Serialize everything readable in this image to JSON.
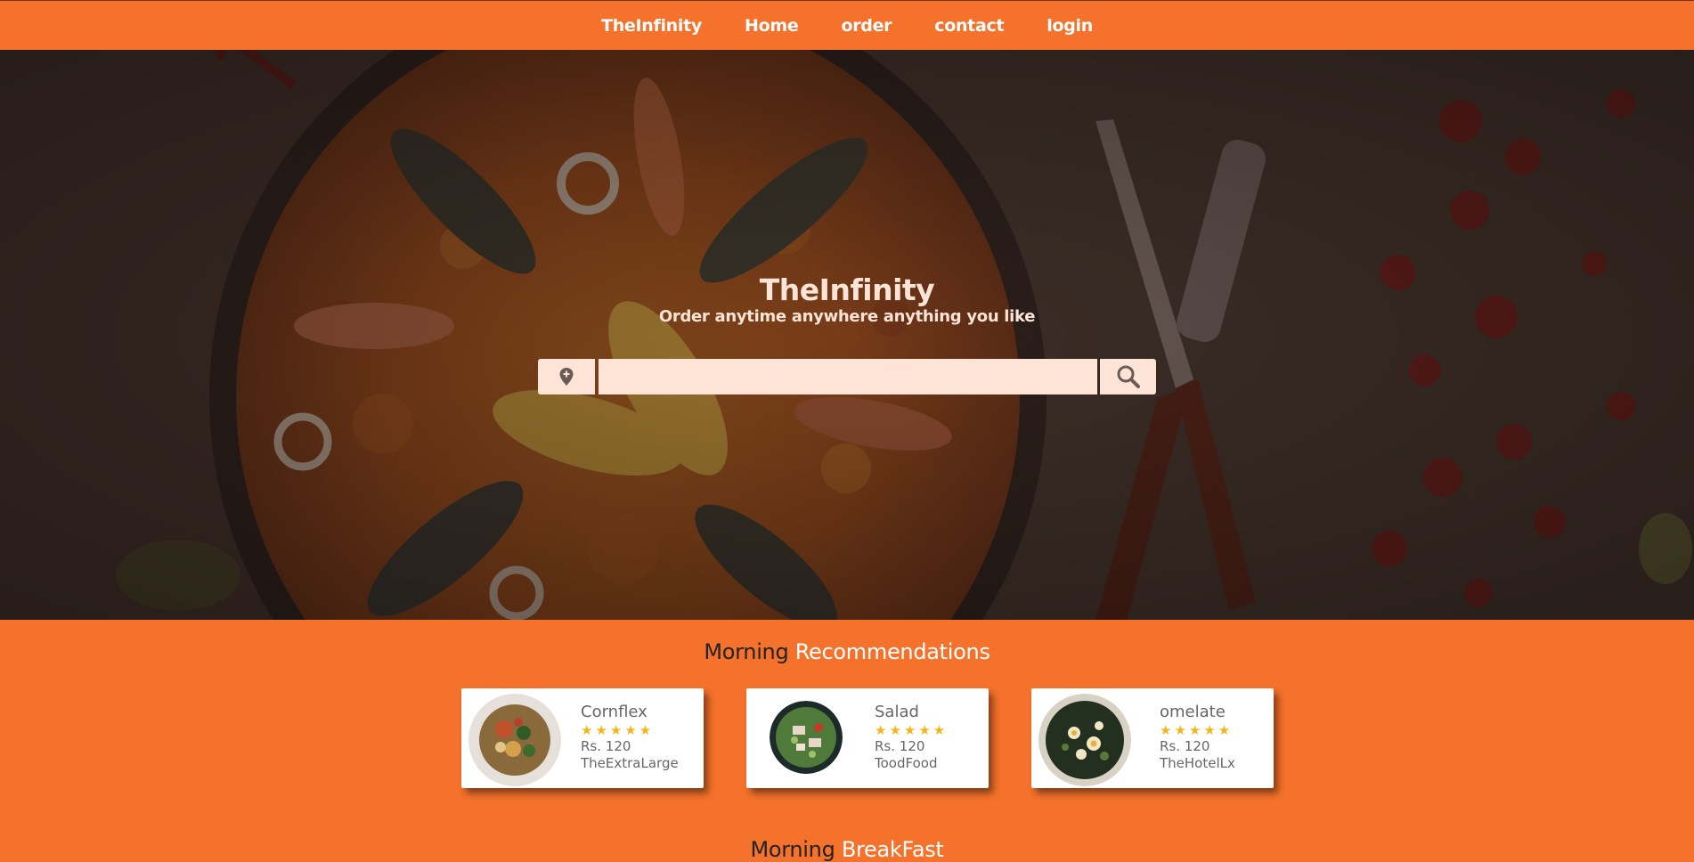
{
  "nav": {
    "items": [
      {
        "label": "TheInfinity"
      },
      {
        "label": "Home"
      },
      {
        "label": "order"
      },
      {
        "label": "contact"
      },
      {
        "label": "login"
      }
    ]
  },
  "hero": {
    "title": "TheInfinity",
    "subtitle": "Order anytime anywhere anything you like",
    "search": {
      "value": "",
      "placeholder": ""
    }
  },
  "sections": [
    {
      "title_plain": "Morning",
      "title_accent": "Recommendations"
    },
    {
      "title_plain": "Morning",
      "title_accent": "BreakFast"
    }
  ],
  "cards": [
    {
      "name": "Cornflex",
      "rating": 5,
      "stars": "★★★★★",
      "price": "Rs. 120",
      "shop": "TheExtraLarge"
    },
    {
      "name": "Salad",
      "rating": 5,
      "stars": "★★★★★",
      "price": "Rs. 120",
      "shop": "ToodFood"
    },
    {
      "name": "omelate",
      "rating": 5,
      "stars": "★★★★★",
      "price": "Rs. 120",
      "shop": "TheHotelLx"
    }
  ],
  "colors": {
    "brand": "#f4722b",
    "hero_text": "#fde4d6",
    "star": "#f5b51a"
  }
}
